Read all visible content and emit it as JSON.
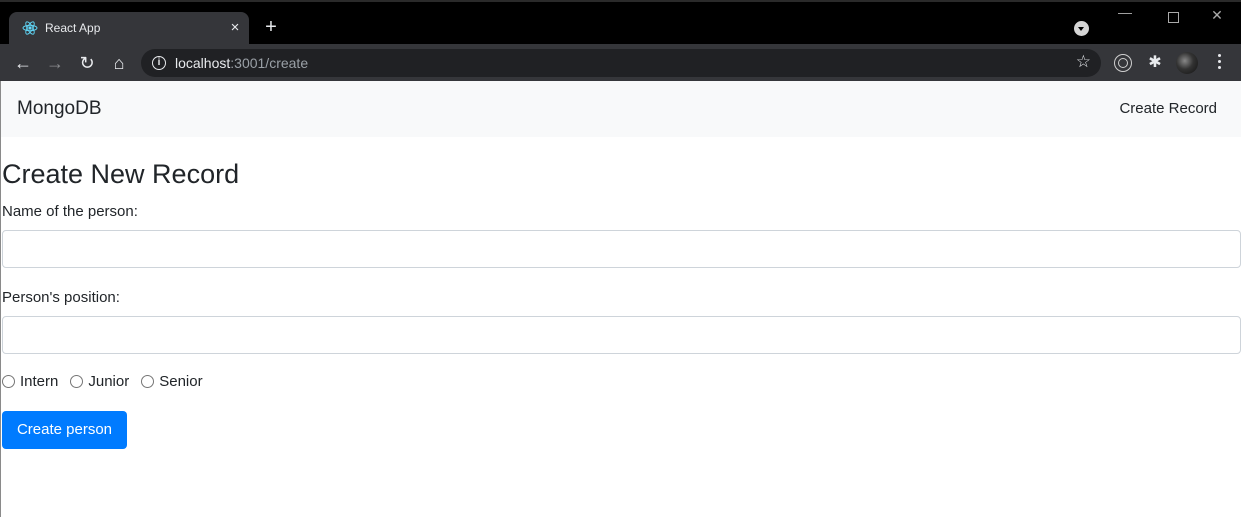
{
  "browser": {
    "tab_title": "React App",
    "tab_close_icon": "×",
    "new_tab_icon": "+",
    "url_host": "localhost",
    "url_rest": ":3001/create",
    "info_icon": "i",
    "star_icon": "☆",
    "puzzle_icon": "✱",
    "window_controls": {
      "minimize": "—",
      "close": "✕"
    },
    "nav": {
      "back": "←",
      "forward": "→",
      "reload": "↻",
      "home": "⌂"
    }
  },
  "navbar": {
    "brand": "MongoDB",
    "link": "Create Record"
  },
  "form": {
    "title": "Create New Record",
    "name_label": "Name of the person:",
    "name_value": "",
    "position_label": "Person's position:",
    "position_value": "",
    "level_options": [
      {
        "label": "Intern",
        "checked": false
      },
      {
        "label": "Junior",
        "checked": false
      },
      {
        "label": "Senior",
        "checked": false
      }
    ],
    "submit_label": "Create person"
  },
  "colors": {
    "primary": "#007bff",
    "navbar_bg": "#f8f9fa",
    "chrome_bg": "#35363a",
    "titlebar_bg": "#000000"
  }
}
